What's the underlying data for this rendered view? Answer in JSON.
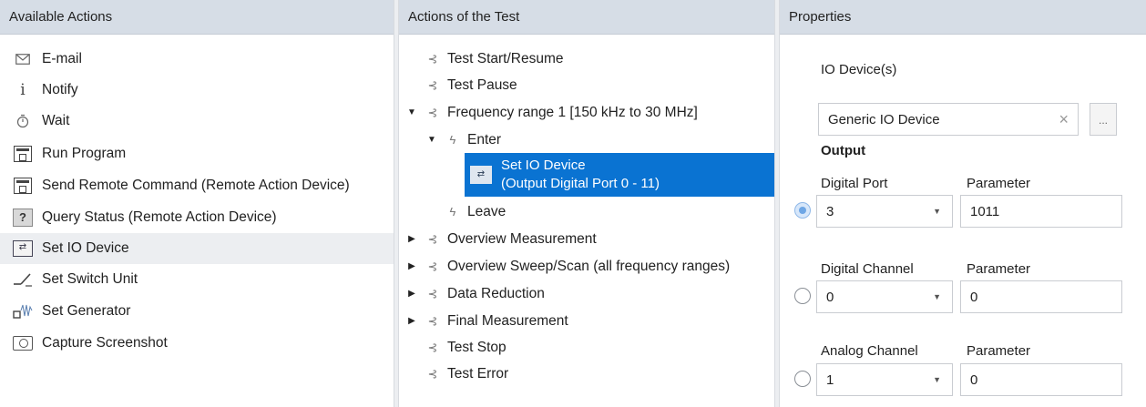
{
  "available_actions": {
    "header": "Available Actions",
    "items": [
      {
        "label": "E-mail",
        "icon": "envelope-icon"
      },
      {
        "label": "Notify",
        "icon": "info-icon"
      },
      {
        "label": "Wait",
        "icon": "stopwatch-icon"
      },
      {
        "label": "Run Program",
        "icon": "run-program-icon"
      },
      {
        "label": "Send Remote Command (Remote Action Device)",
        "icon": "remote-command-icon"
      },
      {
        "label": "Query Status (Remote Action Device)",
        "icon": "query-status-icon"
      },
      {
        "label": "Set IO Device",
        "icon": "io-device-icon"
      },
      {
        "label": "Set Switch Unit",
        "icon": "switch-unit-icon"
      },
      {
        "label": "Set Generator",
        "icon": "generator-icon"
      },
      {
        "label": "Capture Screenshot",
        "icon": "camera-icon"
      }
    ],
    "selected": "Set IO Device"
  },
  "test_actions": {
    "header": "Actions of the Test",
    "nodes": {
      "test_start": "Test Start/Resume",
      "test_pause": "Test Pause",
      "freq_range": "Frequency range 1 [150 kHz to 30 MHz]",
      "enter": "Enter",
      "set_io_line1": "Set IO Device",
      "set_io_line2": "(Output Digital Port 0 - 11)",
      "leave": "Leave",
      "overview_measurement": "Overview Measurement",
      "overview_sweep": "Overview Sweep/Scan (all frequency ranges)",
      "data_reduction": "Data Reduction",
      "final_measurement": "Final Measurement",
      "test_stop": "Test Stop",
      "test_error": "Test Error"
    }
  },
  "properties": {
    "header": "Properties",
    "io_devices_label": "IO Device(s)",
    "io_device_value": "Generic IO Device",
    "browse_label": "...",
    "output_label": "Output",
    "digital_port_label": "Digital Port",
    "digital_port_value": "3",
    "digital_port_param_label": "Parameter",
    "digital_port_param": "1011",
    "digital_channel_label": "Digital Channel",
    "digital_channel_value": "0",
    "digital_channel_param_label": "Parameter",
    "digital_channel_param": "0",
    "analog_channel_label": "Analog Channel",
    "analog_channel_value": "1",
    "analog_channel_param_label": "Parameter",
    "analog_channel_param": "0",
    "selected_output": "Digital Port"
  },
  "colors": {
    "header_bg": "#d6dde6",
    "selection_blue": "#0a73d2",
    "selected_row_bg": "#eceef1"
  }
}
